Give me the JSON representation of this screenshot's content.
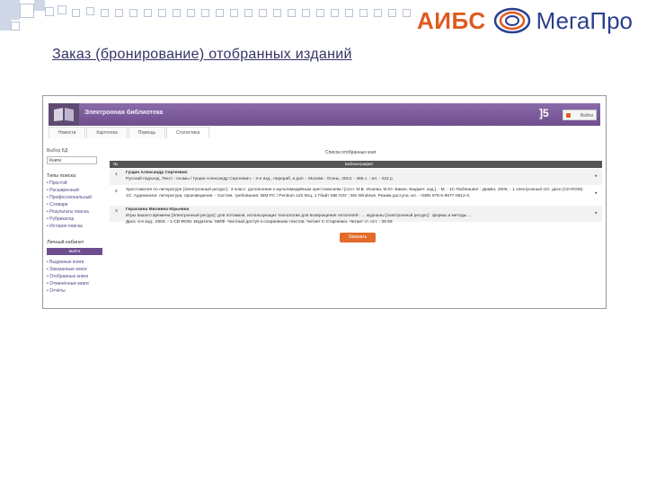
{
  "brand": {
    "name_left": "АИБС",
    "name_right": "МегаПро",
    "accent": "#e05a1e",
    "brand_blue": "#2b3f8f"
  },
  "slide": {
    "title": "Заказ (бронирование) отобранных изданий"
  },
  "screenshot": {
    "header": {
      "title": "Электронная библиотека",
      "corner_mark": "]5",
      "login_label": "Войти"
    },
    "tabs": [
      "Новости",
      "Картотека",
      "Помощь",
      "Статистика"
    ],
    "sidebar": {
      "db_label": "Выбор БД",
      "db_value": "Книги",
      "search_title": "Типы поиска",
      "search_items": [
        "Простой",
        "Расширенный",
        "Профессиональный",
        "Словари",
        "Результаты поиска",
        "Рубрикатор",
        "История поиска"
      ],
      "cabinet_title": "Личный кабинет",
      "cabinet_button": "выйти",
      "cabinet_items": [
        "Выданные книги",
        "Заказанные книги",
        "Отобранные книги",
        "Отменённые книги",
        "Отчёты"
      ]
    },
    "main": {
      "list_title": "Список отобранных книг",
      "columns": [
        "№",
        "Библиография"
      ],
      "rows": [
        {
          "num": "1",
          "line1": "Гущин Александр Сергеевич",
          "line2": "Русский подъезд. Текст : поэмы / Гущин Александр Сергеевич. - 2-е изд., перераб. и доп. - Москва : Осень, 2013. - 455 с. : ил. - 222 р.",
          "line3": ""
        },
        {
          "num": "2",
          "line1": "Хрестоматия по литературе [Электронный ресурс] : 3 класс: дополнение к мультимедийным хрестоматиям / [сост. М.В. Исаева, М.Ю. Викин. Бюджет. изд.]. - М. : 1С-Паблишинг : ДиаБо, 2005. - 1 электронный опт. диск (CD-ROM). -",
          "line2": "1С: Аудиокниги: литература, произведения. - Систем. требования: IBM PC / Pentium 120 Мгц, 1 Гбайт MB ОЗУ ; MS Windows. Режим доступа: ил. - ISBN 978-5-9677-0612-3.",
          "line3": ""
        },
        {
          "num": "3",
          "line1": "Гераскина Милияна Юрьевна",
          "line2": "Игры вашего времени [Электронный ресурс]: для потомков, использующих технологии для возвращения читателей : ... журналы [электронный ресурс] : формы и методы ...",
          "line3": "Диск. 4-е изд., 2004. - 1 CD-ROM. Издатель: МИФ. Частный доступ к сохранению текстов. Читает С.Старченко. Читает ст. ост. - 39 69"
        }
      ],
      "order_button": "Заказать"
    },
    "colors": {
      "header_purple": "#7a5a9a",
      "order_button": "#e36c2a",
      "table_head": "#555555"
    }
  }
}
